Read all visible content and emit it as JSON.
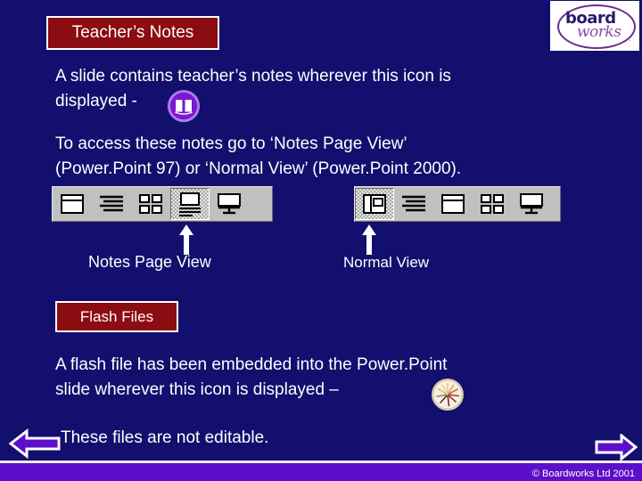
{
  "slide": {
    "background_color": "#120f6e",
    "accent_heading_bg": "#8b0c11",
    "footer_bar_color": "#5b0fc9"
  },
  "logo": {
    "name": "Boardworks",
    "word_top": "board",
    "word_bottom": "works",
    "dots": "...",
    "outline_color": "#6b2d8f"
  },
  "headings": {
    "teachers_notes": "Teacher’s Notes",
    "flash_files": "Flash Files"
  },
  "paragraphs": {
    "notes_icon": "A slide contains teacher’s notes wherever this icon is\ndisplayed -",
    "access_notes": "To access these notes go to ‘Notes Page View’\n(Power.Point 97) or ‘Normal View’ (Power.Point 2000).",
    "flash_embedded": "A flash file has been embedded into the Power.Point\nslide wherever this icon is displayed –",
    "not_editable": "These files are not editable."
  },
  "icons": {
    "teachers_notes_icon": "open-book-icon",
    "flash_icon": "flash-starburst-icon"
  },
  "toolbars": [
    {
      "id": "powerpoint-97-view-toolbar",
      "buttons": [
        {
          "name": "slide-view-button",
          "selected": false
        },
        {
          "name": "outline-view-button",
          "selected": false
        },
        {
          "name": "slide-sorter-view-button",
          "selected": false
        },
        {
          "name": "notes-page-view-button",
          "selected": true
        },
        {
          "name": "slide-show-view-button",
          "selected": false
        }
      ],
      "caption": "Notes Page View"
    },
    {
      "id": "powerpoint-2000-view-toolbar",
      "buttons": [
        {
          "name": "normal-view-button",
          "selected": true
        },
        {
          "name": "outline-view-button",
          "selected": false
        },
        {
          "name": "slide-view-button",
          "selected": false
        },
        {
          "name": "slide-sorter-view-button",
          "selected": false
        },
        {
          "name": "slide-show-view-button",
          "selected": false
        }
      ],
      "caption": "Normal View"
    }
  ],
  "navigation": {
    "previous_label": "previous-slide-arrow",
    "next_label": "next-slide-arrow",
    "arrow_fill": "#5b0fc9"
  },
  "footer": {
    "copyright": "© Boardworks Ltd 2001"
  }
}
